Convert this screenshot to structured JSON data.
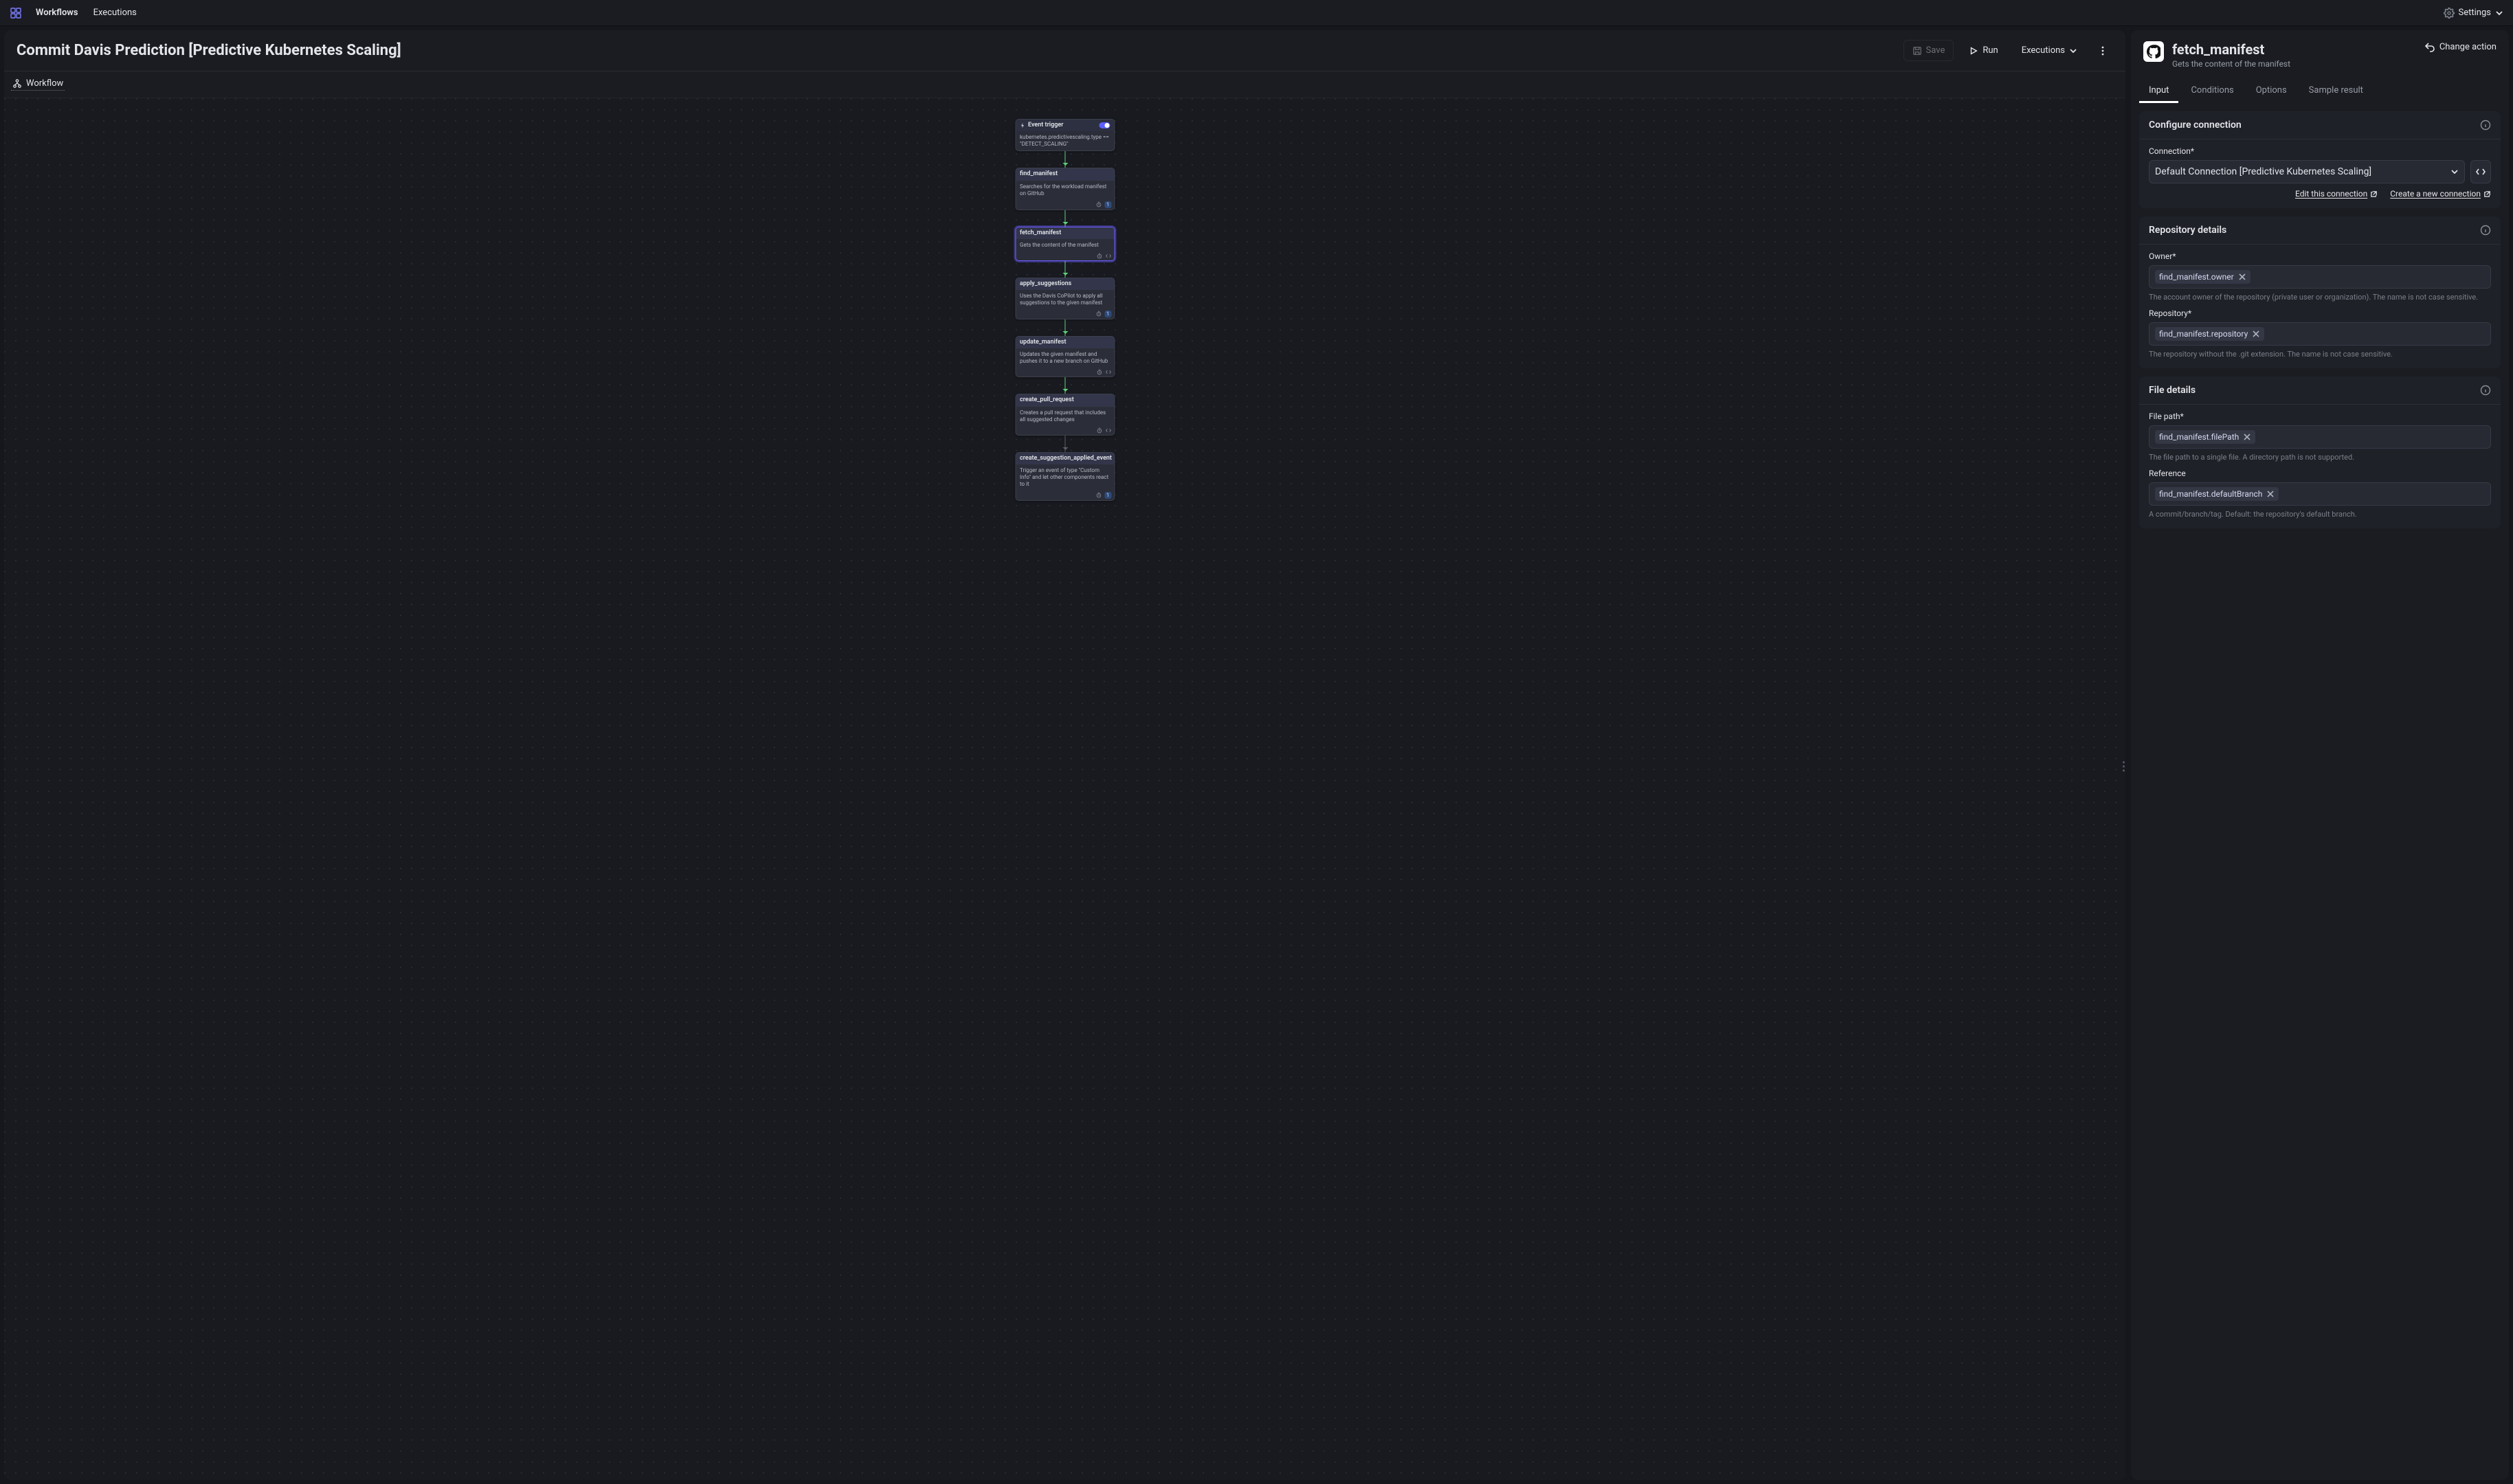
{
  "topnav": {
    "workflows": "Workflows",
    "executions": "Executions",
    "settings": "Settings"
  },
  "canvas": {
    "title": "Commit Davis Prediction [Predictive Kubernetes Scaling]",
    "save": "Save",
    "run": "Run",
    "executions": "Executions",
    "workflow_tab": "Workflow"
  },
  "nodes": {
    "trigger": {
      "title": "Event trigger",
      "body": "kubernetes.predictivescaling.type == \"DETECT_SCALING\""
    },
    "find": {
      "title": "find_manifest",
      "body": "Searches for the workload manifest on GitHub",
      "pill": "1"
    },
    "fetch": {
      "title": "fetch_manifest",
      "body": "Gets the content of the manifest"
    },
    "apply": {
      "title": "apply_suggestions",
      "body": "Uses the Davis CoPilot to apply all suggestions to the given manifest",
      "pill": "1"
    },
    "update": {
      "title": "update_manifest",
      "body": "Updates the given manifest and pushes it to a new branch on GitHub"
    },
    "pull": {
      "title": "create_pull_request",
      "body": "Creates a pull request that includes all suggested changes"
    },
    "event2": {
      "title": "create_suggestion_applied_event",
      "body": "Trigger an event of type \"Custom Info\" and let other components react to it",
      "pill": "1"
    }
  },
  "right": {
    "title": "fetch_manifest",
    "subtitle": "Gets the content of the manifest",
    "change_action": "Change action",
    "tabs": {
      "input": "Input",
      "conditions": "Conditions",
      "options": "Options",
      "sample": "Sample result"
    },
    "sec_conn": {
      "heading": "Configure connection",
      "conn_label": "Connection*",
      "conn_value": "Default Connection [Predictive Kubernetes Scaling]",
      "edit": "Edit this connection",
      "create": "Create a new connection"
    },
    "sec_repo": {
      "heading": "Repository details",
      "owner_label": "Owner*",
      "owner_chip": "find_manifest.owner",
      "owner_help": "The account owner of the repository (private user or organization). The name is not case sensitive.",
      "repo_label": "Repository*",
      "repo_chip": "find_manifest.repository",
      "repo_help": "The repository without the .git extension. The name is not case sensitive."
    },
    "sec_file": {
      "heading": "File details",
      "path_label": "File path*",
      "path_chip": "find_manifest.filePath",
      "path_help": "The file path to a single file. A directory path is not supported.",
      "ref_label": "Reference",
      "ref_chip": "find_manifest.defaultBranch",
      "ref_help": "A commit/branch/tag. Default: the repository's default branch."
    }
  }
}
